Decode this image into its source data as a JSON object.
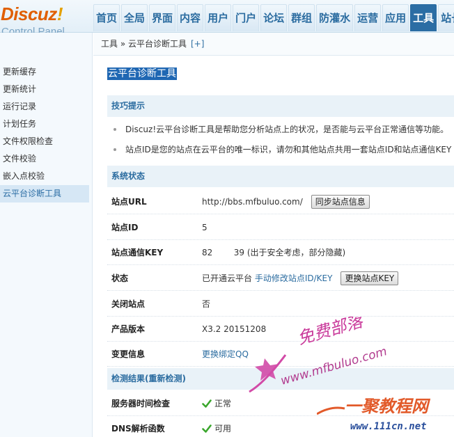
{
  "header": {
    "logo_main": "Discuz",
    "logo_bang": "!",
    "logo_sub": "Control Panel",
    "nav": [
      {
        "label": "首页"
      },
      {
        "label": "全局"
      },
      {
        "label": "界面"
      },
      {
        "label": "内容"
      },
      {
        "label": "用户"
      },
      {
        "label": "门户"
      },
      {
        "label": "论坛"
      },
      {
        "label": "群组"
      },
      {
        "label": "防灌水"
      },
      {
        "label": "运营"
      },
      {
        "label": "应用"
      },
      {
        "label": "工具"
      },
      {
        "label": "站长"
      }
    ],
    "active_nav": "工具"
  },
  "sidebar": {
    "items": [
      {
        "label": "更新缓存"
      },
      {
        "label": "更新统计"
      },
      {
        "label": "运行记录"
      },
      {
        "label": "计划任务"
      },
      {
        "label": "文件权限检查"
      },
      {
        "label": "文件校验"
      },
      {
        "label": "嵌入点校验"
      },
      {
        "label": "云平台诊断工具"
      }
    ],
    "active_item": "云平台诊断工具"
  },
  "breadcrumb": {
    "text": "工具 » 云平台诊断工具",
    "plus": "[+]"
  },
  "main": {
    "title": "云平台诊断工具",
    "tips": {
      "heading": "技巧提示",
      "items": [
        "Discuz!云平台诊断工具是帮助您分析站点上的状况，是否能与云平台正常通信等功能。",
        "站点ID是您的站点在云平台的唯一标识，请勿和其他站点共用一套站点ID和站点通信KEY"
      ]
    },
    "status": {
      "heading": "系统状态",
      "rows": [
        {
          "label": "站点URL",
          "value": "http://bbs.mfbuluo.com/",
          "button": "同步站点信息"
        },
        {
          "label": "站点ID",
          "value": "5"
        },
        {
          "label": "站点通信KEY",
          "value": "82        39 (出于安全考虑，部分隐藏)"
        },
        {
          "label": "状态",
          "value": "已开通云平台",
          "link": "手动修改站点ID/KEY",
          "button": "更换站点KEY"
        },
        {
          "label": "关闭站点",
          "value": "否"
        },
        {
          "label": "产品版本",
          "value": "X3.2 20151208"
        },
        {
          "label": "变更信息",
          "link": "更换绑定QQ"
        }
      ]
    },
    "results": {
      "heading": "检测结果",
      "recheck": "(重新检测)",
      "rows": [
        {
          "label": "服务器时间检查",
          "value": "正常"
        },
        {
          "label": "DNS解析函数",
          "value": "可用"
        }
      ]
    }
  },
  "watermark": {
    "cn_text": "免费部落",
    "url_text": "www.mfbuluo.com",
    "logo2_text": "一聚教程网",
    "logo2_url": "www.111cn.net"
  },
  "colors": {
    "accent": "#2b6da4",
    "link": "#2b6ca0",
    "title_bg": "#1f67b3",
    "section_bg": "#e9f2f8",
    "check_green": "#3aa62c"
  }
}
